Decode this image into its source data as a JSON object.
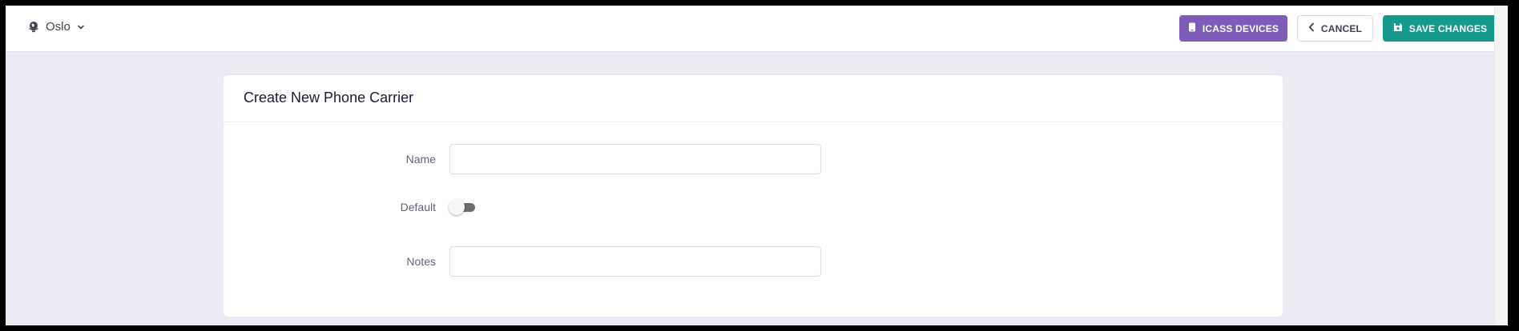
{
  "header": {
    "location": {
      "icon": "globe-icon",
      "label": "Oslo",
      "dropdown_icon": "chevron-down-icon"
    },
    "buttons": {
      "devices": {
        "label": "ICASS DEVICES",
        "icon": "tablet-icon",
        "color": "#7e5bb7"
      },
      "cancel": {
        "label": "CANCEL",
        "icon": "chevron-left-icon"
      },
      "save": {
        "label": "SAVE CHANGES",
        "icon": "floppy-disk-icon",
        "color": "#15998a"
      }
    }
  },
  "form": {
    "title": "Create New Phone Carrier",
    "fields": {
      "name": {
        "label": "Name",
        "value": "",
        "placeholder": ""
      },
      "default": {
        "label": "Default",
        "checked": false
      },
      "notes": {
        "label": "Notes",
        "value": "",
        "placeholder": ""
      }
    }
  },
  "colors": {
    "page_background": "#ecebf3",
    "primary_text": "#181c32",
    "label_text": "#5e6278"
  }
}
